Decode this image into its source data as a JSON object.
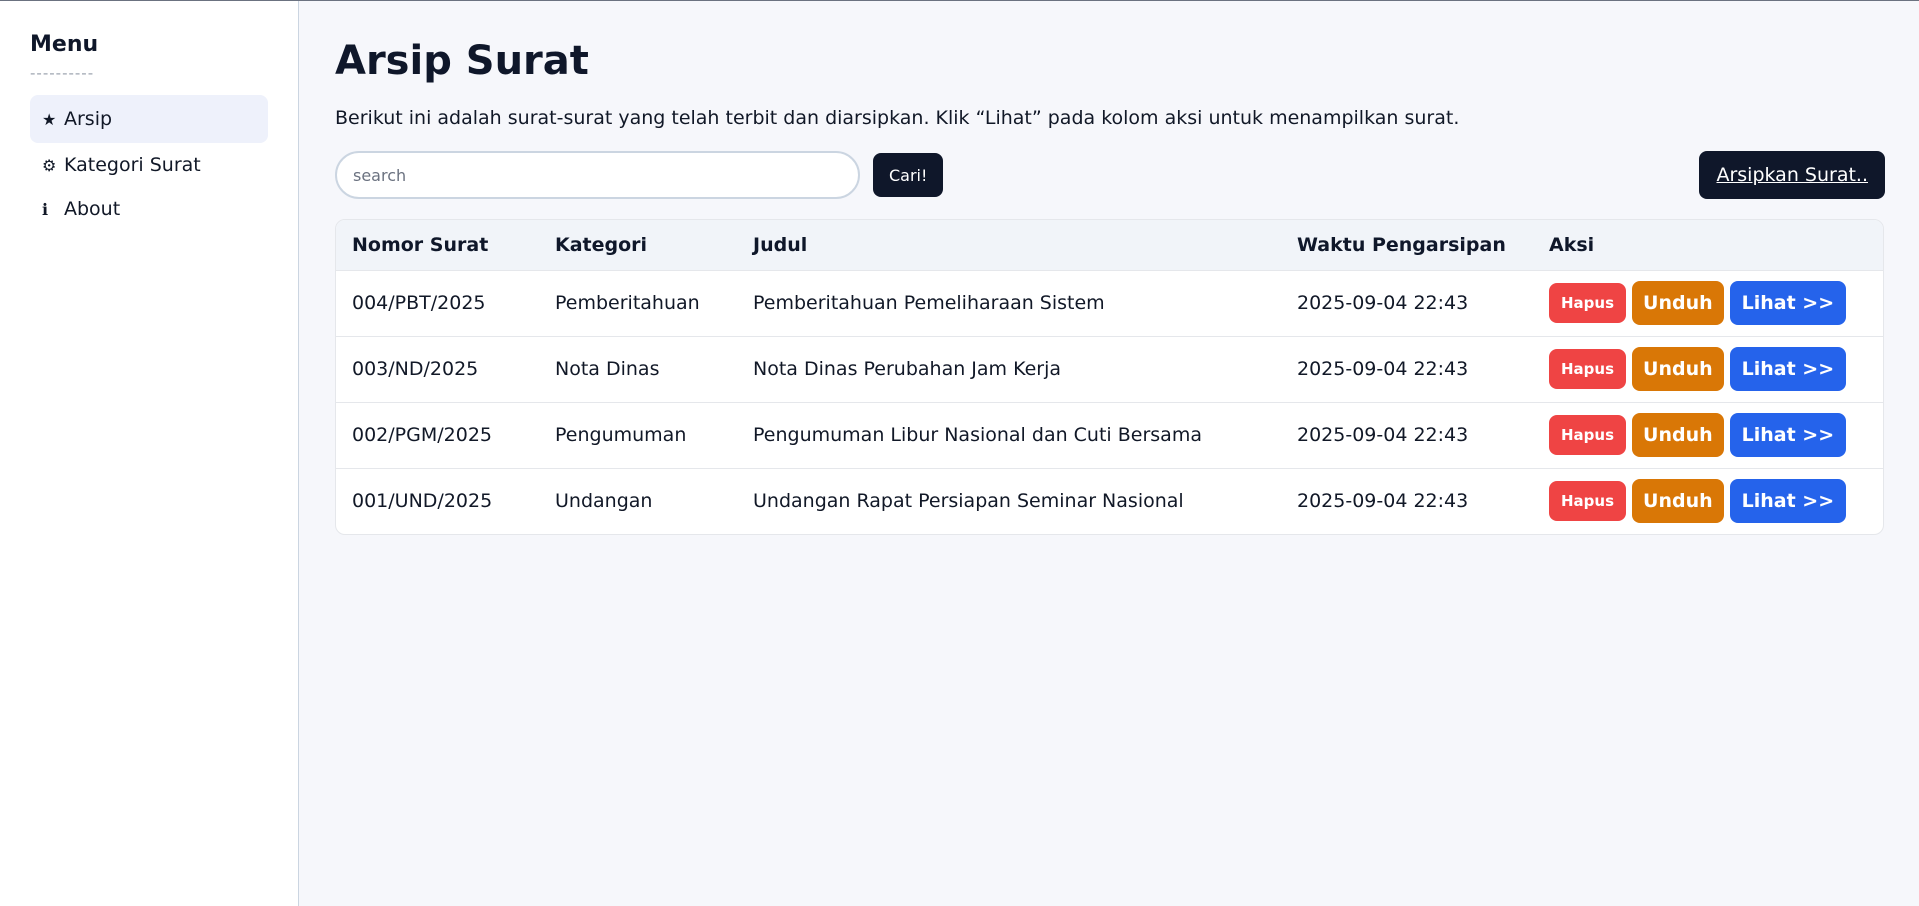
{
  "sidebar": {
    "title": "Menu",
    "divider": "----------",
    "items": [
      {
        "icon": "★",
        "label": "Arsip"
      },
      {
        "icon": "⚙",
        "label": "Kategori Surat"
      },
      {
        "icon": "ℹ",
        "label": "About"
      }
    ]
  },
  "main": {
    "title": "Arsip Surat",
    "description": "Berikut ini adalah surat-surat yang telah terbit dan diarsipkan. Klik “Lihat” pada kolom aksi untuk menampilkan surat.",
    "search": {
      "placeholder": "search",
      "value": "",
      "button_label": "Cari!"
    },
    "archive_button_label": "Arsipkan Surat.."
  },
  "table": {
    "headers": [
      "Nomor Surat",
      "Kategori",
      "Judul",
      "Waktu Pengarsipan",
      "Aksi"
    ],
    "actions": {
      "delete": "Hapus",
      "download": "Unduh",
      "view": "Lihat >>"
    },
    "rows": [
      {
        "nomor": "004/PBT/2025",
        "kategori": "Pemberitahuan",
        "judul": "Pemberitahuan Pemeliharaan Sistem",
        "waktu": "2025-09-04 22:43"
      },
      {
        "nomor": "003/ND/2025",
        "kategori": "Nota Dinas",
        "judul": "Nota Dinas Perubahan Jam Kerja",
        "waktu": "2025-09-04 22:43"
      },
      {
        "nomor": "002/PGM/2025",
        "kategori": "Pengumuman",
        "judul": "Pengumuman Libur Nasional dan Cuti Bersama",
        "waktu": "2025-09-04 22:43"
      },
      {
        "nomor": "001/UND/2025",
        "kategori": "Undangan",
        "judul": "Undangan Rapat Persiapan Seminar Nasional",
        "waktu": "2025-09-04 22:43"
      }
    ]
  },
  "colors": {
    "dark_button": "#0f172a",
    "delete": "#ef4444",
    "download": "#d97706",
    "view": "#2563eb",
    "active_nav": "#eef1fb"
  }
}
